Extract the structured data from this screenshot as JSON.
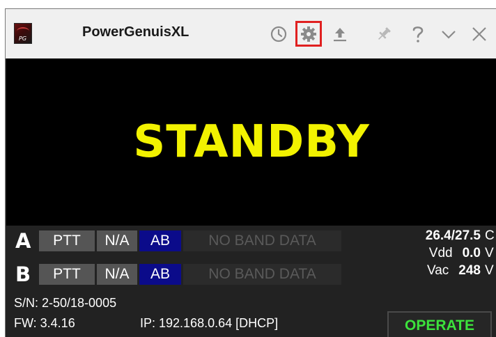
{
  "window": {
    "title": "PowerGenuisXL",
    "icon_label": "PG"
  },
  "toolbar": {
    "buttons": [
      {
        "name": "history",
        "icon": "clock-icon"
      },
      {
        "name": "settings",
        "icon": "gear-icon",
        "highlighted": true
      },
      {
        "name": "upload",
        "icon": "upload-icon"
      },
      {
        "name": "pin",
        "icon": "pin-icon"
      },
      {
        "name": "help",
        "icon": "question-icon"
      },
      {
        "name": "minimize",
        "icon": "chevron-down-icon"
      },
      {
        "name": "close",
        "icon": "close-icon"
      }
    ]
  },
  "status": {
    "text": "STANDBY",
    "color": "#f2f200"
  },
  "radios": [
    {
      "letter": "A",
      "ptt": "PTT",
      "na": "N/A",
      "ab": "AB",
      "band": "NO BAND DATA"
    },
    {
      "letter": "B",
      "ptt": "PTT",
      "na": "N/A",
      "ab": "AB",
      "band": "NO BAND DATA"
    }
  ],
  "metrics": {
    "temperature": {
      "value": "26.4/27.5",
      "unit": "C"
    },
    "vdd": {
      "label": "Vdd",
      "value": "0.0",
      "unit": "V"
    },
    "vac": {
      "label": "Vac",
      "value": "248",
      "unit": "V"
    }
  },
  "info": {
    "serial": "S/N: 2-50/18-0005",
    "firmware": "FW: 3.4.16",
    "ip": "IP: 192.168.0.64 [DHCP]"
  },
  "operate_button": {
    "label": "OPERATE",
    "color": "#3ce23c"
  }
}
